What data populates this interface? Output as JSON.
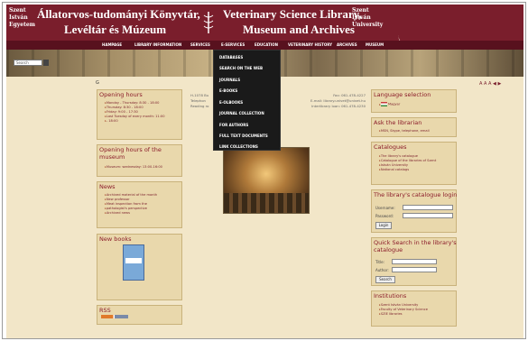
{
  "header": {
    "seal_left": "Szent\nIstván\nEgyetem",
    "seal_right": "Szent\nIstván\nUniversity",
    "title_hu_line1": "Állatorvos-tudományi Könyvtár,",
    "title_hu_line2": "Levéltár és Múzeum",
    "title_en_line1": "Veterinary Science Library,",
    "title_en_line2": "Museum and Archives"
  },
  "menu": [
    "HAMPAGE",
    "LIBRARY INFORMATION",
    "SERVICES",
    "E-SERVICES",
    "EDUCATION",
    "VETERINARY HISTORY",
    "ARCHIVES",
    "MUSEUM"
  ],
  "search": {
    "placeholder": "Search"
  },
  "font_size_ctrl": "A A A ◀ ▶",
  "home_arrow": "G",
  "dropdown": [
    "DATABASES",
    "SEARCH ON THE WEB",
    "JOURNALS",
    "E-BOOKS",
    "E-OLBOOKS",
    "JOURNAL COLLECTION",
    "FOR AUTHORS",
    "FULL TEXT DOCUMENTS",
    "LINK COLLECTIONS"
  ],
  "left": {
    "opening_hours": {
      "title": "Opening hours",
      "items": [
        "Monday - Thursday: 8:30 - 18:00",
        "Thursday: 8:30 - 18:00",
        "Friday: 9:00 - 17:30",
        "Last Tuesday of every month: 11:00",
        "- 18:00"
      ]
    },
    "museum_hours": {
      "title_line1": "Opening hours of the",
      "title_line2": "museum",
      "items": [
        "Museum: wednesday: 13:00-16:00"
      ]
    },
    "news": {
      "title": "News",
      "items": [
        "Archived material of the month",
        "New professor",
        "Meat inspection from the",
        "pathologist's perspective",
        "Archived news"
      ]
    },
    "new_books": {
      "title": "New books"
    },
    "rss": {
      "title": "RSS"
    }
  },
  "middle": {
    "lines_left": [
      "H-1078 Bu",
      "Telephon",
      "Reading ro"
    ],
    "lines_right": [
      "Fax: 061-478-4227",
      "E-mail: library.univet@univet.hu",
      "Interlibrary loan: 061-478-4230"
    ]
  },
  "right": {
    "language": {
      "title": "Language selection",
      "items": [
        "Magyar"
      ]
    },
    "librarian": {
      "title": "Ask the librarian",
      "items": [
        "MSN, Skype, telephone, email"
      ]
    },
    "catalogues": {
      "title": "Catalogues",
      "items": [
        "The library's catalogue",
        "Catalogue of the libraries of Szent",
        "István University",
        "National catalogs"
      ]
    },
    "login": {
      "title_line1": "The library's catalogue login",
      "username_label": "Username:",
      "password_label": "Password:",
      "button": "Login"
    },
    "quick_search": {
      "title_line1": "Quick Search in the library's",
      "title_line2": "catalogue",
      "title_label": "Title:",
      "author_label": "Author:",
      "button": "Search"
    },
    "institutions": {
      "title": "Institutions",
      "items": [
        "Szent István University",
        "Faculty of Veterinary Science",
        "SZIE libraries"
      ]
    }
  }
}
